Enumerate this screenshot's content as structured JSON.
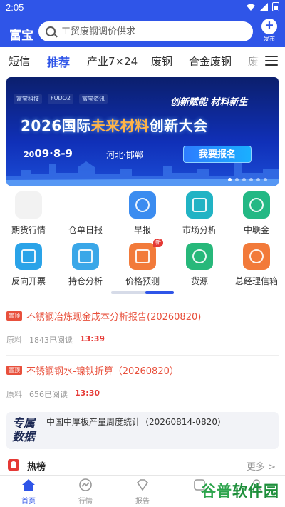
{
  "status_bar": {
    "time": "2:05"
  },
  "header": {
    "brand": "富宝",
    "search_placeholder": "工贸废钢调价供求",
    "publish_label": "发布",
    "color": "#2f55e8"
  },
  "tabs": [
    {
      "label": "短信",
      "active": false
    },
    {
      "label": "推荐",
      "active": true
    },
    {
      "label": "产业7×24",
      "active": false
    },
    {
      "label": "废钢",
      "active": false
    },
    {
      "label": "合金废钢",
      "active": false
    },
    {
      "label": "废",
      "active": false
    }
  ],
  "banner": {
    "logos": [
      "富宝科技",
      "FUDO2",
      "富宝资讯"
    ],
    "slogan": "创新赋能  材料新生",
    "title_pre": "2026国际",
    "title_highlight": "未来材料",
    "title_post": "创新大会",
    "date": "09·8-9",
    "date_prefix": "20",
    "city": "河北·邯郸",
    "cta": "我要报名"
  },
  "grid_items": [
    {
      "label": "期货行情",
      "icon": "futures-icon",
      "color": "#f0f0f0"
    },
    {
      "label": "仓单日报",
      "icon": "warehouse-receipt-icon",
      "color": "#ffffff"
    },
    {
      "label": "早报",
      "icon": "alarm-clock-icon",
      "color": "#3b8cf0"
    },
    {
      "label": "市场分析",
      "icon": "chart-icon",
      "color": "#21b3c4"
    },
    {
      "label": "中联金",
      "icon": "cloud-icon",
      "color": "#23b884"
    },
    {
      "label": "反向开票",
      "icon": "ticket-icon",
      "color": "#2aa3e8"
    },
    {
      "label": "持仓分析",
      "icon": "layers-icon",
      "color": "#3aa7e8"
    },
    {
      "label": "价格预测",
      "icon": "radio-icon",
      "color": "#f27a3a",
      "badge": "新"
    },
    {
      "label": "货源",
      "icon": "goods-icon",
      "color": "#27b87a"
    },
    {
      "label": "总经理信箱",
      "icon": "tie-icon",
      "color": "#f27a3a"
    }
  ],
  "news": [
    {
      "tag": "置顶",
      "title": "不锈钢冶炼现金成本分析报告(20260820)",
      "source": "原料",
      "reads": "1843已阅读",
      "time": "13:39"
    },
    {
      "tag": "置顶",
      "title": "不锈钢钢水-镍铁折算（20260820）",
      "source": "原料",
      "reads": "656已阅读",
      "time": "13:30"
    }
  ],
  "special": {
    "logo_line1": "专属",
    "logo_line2": "数据",
    "title": "中国中厚板产量周度统计（20260814-0820）"
  },
  "hot": {
    "title": "热榜",
    "more": "更多 >"
  },
  "bottom_nav": [
    {
      "label": "首页",
      "active": true
    },
    {
      "label": "行情",
      "active": false
    },
    {
      "label": "报告",
      "active": false
    },
    {
      "label": "",
      "active": false
    },
    {
      "label": "",
      "active": false
    }
  ],
  "watermark": {
    "part1": "谷普",
    "part2": "软件园"
  }
}
